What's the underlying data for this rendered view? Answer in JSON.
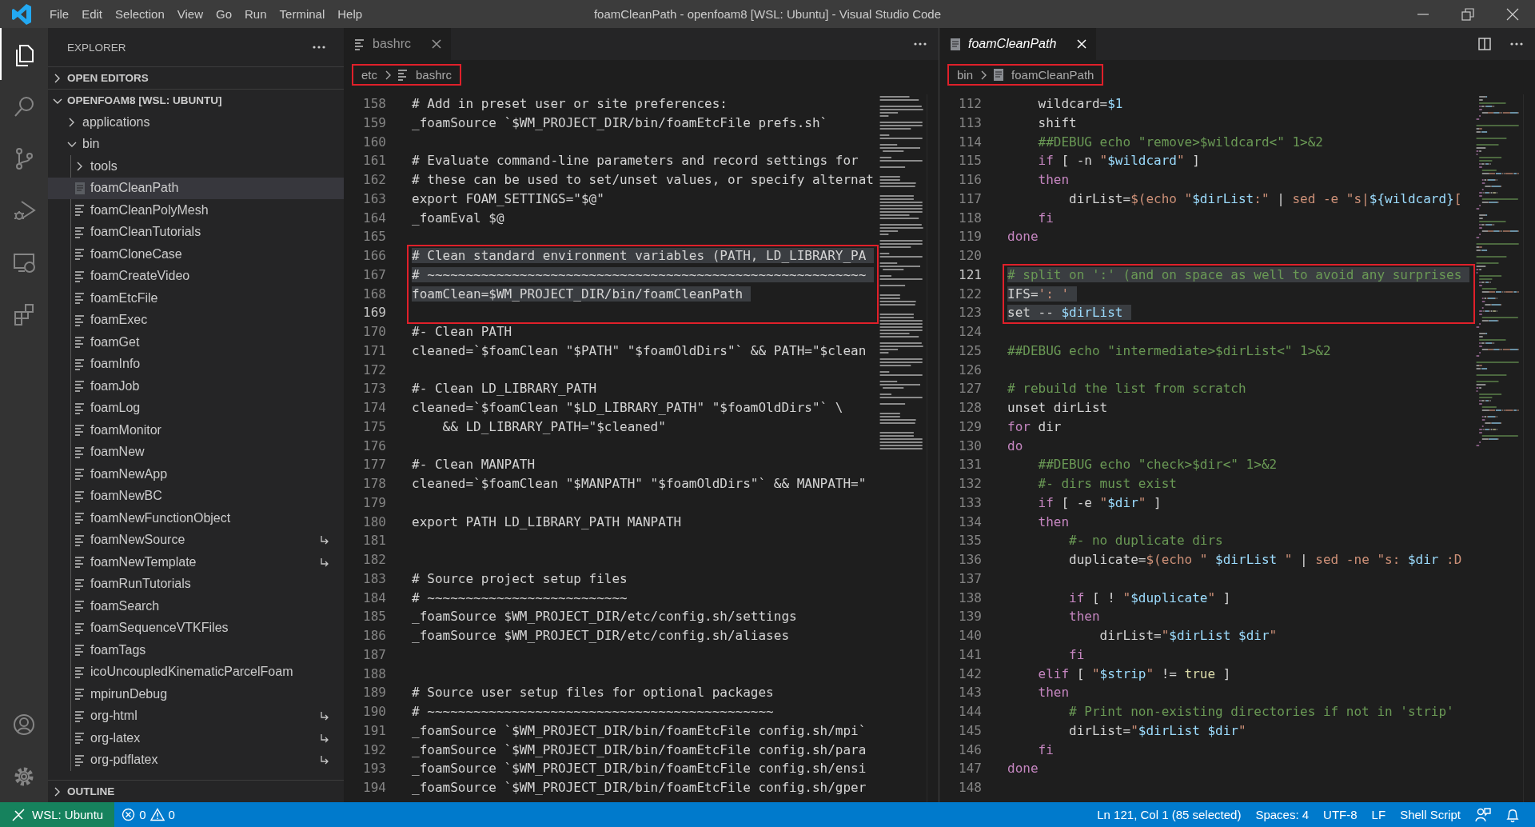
{
  "title_bar": {
    "menu": [
      "File",
      "Edit",
      "Selection",
      "View",
      "Go",
      "Run",
      "Terminal",
      "Help"
    ],
    "title": "foamCleanPath - openfoam8 [WSL: Ubuntu] - Visual Studio Code"
  },
  "activity_bar": {
    "top": [
      {
        "kind": "explorer",
        "selected": true
      },
      {
        "kind": "search",
        "selected": false
      },
      {
        "kind": "source_control",
        "selected": false
      },
      {
        "kind": "run",
        "selected": false
      },
      {
        "kind": "remote",
        "selected": false
      },
      {
        "kind": "extensions",
        "selected": false
      }
    ],
    "bottom": [
      {
        "kind": "account"
      },
      {
        "kind": "settings"
      }
    ]
  },
  "sidebar": {
    "title": "EXPLORER",
    "sections": [
      {
        "label": "OPEN EDITORS",
        "expanded": false
      },
      {
        "label": "OPENFOAM8 [WSL: UBUNTU]",
        "expanded": true,
        "tree": [
          {
            "label": "applications",
            "kind": "folder",
            "expanded": false,
            "selected": false
          },
          {
            "label": "bin",
            "kind": "folder",
            "expanded": true,
            "selected": false,
            "children": [
              {
                "label": "tools",
                "kind": "folder",
                "expanded": false,
                "selected": false
              },
              {
                "label": "foamCleanPath",
                "kind": "shellfile",
                "selected": true,
                "symlink": false
              },
              {
                "label": "foamCleanPolyMesh",
                "kind": "file",
                "selected": false,
                "symlink": false
              },
              {
                "label": "foamCleanTutorials",
                "kind": "file",
                "selected": false,
                "symlink": false
              },
              {
                "label": "foamCloneCase",
                "kind": "file",
                "selected": false,
                "symlink": false
              },
              {
                "label": "foamCreateVideo",
                "kind": "file",
                "selected": false,
                "symlink": false
              },
              {
                "label": "foamEtcFile",
                "kind": "file",
                "selected": false,
                "symlink": false
              },
              {
                "label": "foamExec",
                "kind": "file",
                "selected": false,
                "symlink": false
              },
              {
                "label": "foamGet",
                "kind": "file",
                "selected": false,
                "symlink": false
              },
              {
                "label": "foamInfo",
                "kind": "file",
                "selected": false,
                "symlink": false
              },
              {
                "label": "foamJob",
                "kind": "file",
                "selected": false,
                "symlink": false
              },
              {
                "label": "foamLog",
                "kind": "file",
                "selected": false,
                "symlink": false
              },
              {
                "label": "foamMonitor",
                "kind": "file",
                "selected": false,
                "symlink": false
              },
              {
                "label": "foamNew",
                "kind": "file",
                "selected": false,
                "symlink": false
              },
              {
                "label": "foamNewApp",
                "kind": "file",
                "selected": false,
                "symlink": false
              },
              {
                "label": "foamNewBC",
                "kind": "file",
                "selected": false,
                "symlink": false
              },
              {
                "label": "foamNewFunctionObject",
                "kind": "file",
                "selected": false,
                "symlink": false
              },
              {
                "label": "foamNewSource",
                "kind": "file",
                "selected": false,
                "symlink": true
              },
              {
                "label": "foamNewTemplate",
                "kind": "file",
                "selected": false,
                "symlink": true
              },
              {
                "label": "foamRunTutorials",
                "kind": "file",
                "selected": false,
                "symlink": false
              },
              {
                "label": "foamSearch",
                "kind": "file",
                "selected": false,
                "symlink": false
              },
              {
                "label": "foamSequenceVTKFiles",
                "kind": "file",
                "selected": false,
                "symlink": false
              },
              {
                "label": "foamTags",
                "kind": "file",
                "selected": false,
                "symlink": false
              },
              {
                "label": "icoUncoupledKinematicParcelFoam",
                "kind": "file",
                "selected": false,
                "symlink": false
              },
              {
                "label": "mpirunDebug",
                "kind": "file",
                "selected": false,
                "symlink": false
              },
              {
                "label": "org-html",
                "kind": "file",
                "selected": false,
                "symlink": true
              },
              {
                "label": "org-latex",
                "kind": "file",
                "selected": false,
                "symlink": true
              },
              {
                "label": "org-pdflatex",
                "kind": "file",
                "selected": false,
                "symlink": true
              }
            ]
          }
        ]
      },
      {
        "label": "OUTLINE",
        "expanded": false
      }
    ]
  },
  "editors": [
    {
      "focused": false,
      "tabs": [
        {
          "label": "bashrc",
          "kind": "lines",
          "selected": true,
          "preview": false
        }
      ],
      "actions": [
        {
          "kind": "more"
        }
      ],
      "breadcrumbs": {
        "boxed": true,
        "items": [
          {
            "label": "etc",
            "kind": "folder"
          },
          {
            "label": "bashrc",
            "kind": "lines"
          }
        ]
      },
      "blocks": [
        {
          "boxed": false,
          "lines": [
            {
              "n": "158",
              "selected": false,
              "current": false,
              "text": "# Add in preset user or site preferences:"
            },
            {
              "n": "159",
              "selected": false,
              "current": false,
              "text": "_foamSource `$WM_PROJECT_DIR/bin/foamEtcFile prefs.sh`"
            },
            {
              "n": "160",
              "selected": false,
              "current": false
            },
            {
              "n": "161",
              "selected": false,
              "current": false,
              "text": "# Evaluate command-line parameters and record settings for"
            },
            {
              "n": "162",
              "selected": false,
              "current": false,
              "text": "# these can be used to set/unset values, or specify alternat"
            },
            {
              "n": "163",
              "selected": false,
              "current": false,
              "text": "export FOAM_SETTINGS=\"$@\""
            },
            {
              "n": "164",
              "selected": false,
              "current": false,
              "text": "_foamEval $@"
            },
            {
              "n": "165",
              "selected": false,
              "current": false
            }
          ]
        },
        {
          "boxed": true,
          "lines": [
            {
              "n": "166",
              "selected": true,
              "current": false,
              "text": "# Clean standard environment variables (PATH, LD_LIBRARY_PA"
            },
            {
              "n": "167",
              "selected": true,
              "current": false,
              "text": "# ~~~~~~~~~~~~~~~~~~~~~~~~~~~~~~~~~~~~~~~~~~~~~~~~~~~~~~~~~"
            },
            {
              "n": "168",
              "selected": true,
              "current": false,
              "text": "foamClean=$WM_PROJECT_DIR/bin/foamCleanPath"
            },
            {
              "n": "169",
              "selected": false,
              "current": true
            }
          ]
        },
        {
          "boxed": false,
          "lines": [
            {
              "n": "170",
              "selected": false,
              "current": false,
              "text": "#- Clean PATH"
            },
            {
              "n": "171",
              "selected": false,
              "current": false,
              "text": "cleaned=`$foamClean \"$PATH\" \"$foamOldDirs\"` && PATH=\"$clean"
            },
            {
              "n": "172",
              "selected": false,
              "current": false
            },
            {
              "n": "173",
              "selected": false,
              "current": false,
              "text": "#- Clean LD_LIBRARY_PATH"
            },
            {
              "n": "174",
              "selected": false,
              "current": false,
              "text": "cleaned=`$foamClean \"$LD_LIBRARY_PATH\" \"$foamOldDirs\"` \\"
            },
            {
              "n": "175",
              "selected": false,
              "current": false,
              "text": "    && LD_LIBRARY_PATH=\"$cleaned\""
            },
            {
              "n": "176",
              "selected": false,
              "current": false
            },
            {
              "n": "177",
              "selected": false,
              "current": false,
              "text": "#- Clean MANPATH"
            },
            {
              "n": "178",
              "selected": false,
              "current": false,
              "text": "cleaned=`$foamClean \"$MANPATH\" \"$foamOldDirs\"` && MANPATH=\""
            },
            {
              "n": "179",
              "selected": false,
              "current": false
            },
            {
              "n": "180",
              "selected": false,
              "current": false,
              "text": "export PATH LD_LIBRARY_PATH MANPATH"
            },
            {
              "n": "181",
              "selected": false,
              "current": false
            },
            {
              "n": "182",
              "selected": false,
              "current": false
            },
            {
              "n": "183",
              "selected": false,
              "current": false,
              "text": "# Source project setup files"
            },
            {
              "n": "184",
              "selected": false,
              "current": false,
              "text": "# ~~~~~~~~~~~~~~~~~~~~~~~~~~"
            },
            {
              "n": "185",
              "selected": false,
              "current": false,
              "text": "_foamSource $WM_PROJECT_DIR/etc/config.sh/settings"
            },
            {
              "n": "186",
              "selected": false,
              "current": false,
              "text": "_foamSource $WM_PROJECT_DIR/etc/config.sh/aliases"
            },
            {
              "n": "187",
              "selected": false,
              "current": false
            },
            {
              "n": "188",
              "selected": false,
              "current": false
            },
            {
              "n": "189",
              "selected": false,
              "current": false,
              "text": "# Source user setup files for optional packages"
            },
            {
              "n": "190",
              "selected": false,
              "current": false,
              "text": "# ~~~~~~~~~~~~~~~~~~~~~~~~~~~~~~~~~~~~~~~~~~~~~"
            },
            {
              "n": "191",
              "selected": false,
              "current": false,
              "text": "_foamSource `$WM_PROJECT_DIR/bin/foamEtcFile config.sh/mpi`"
            },
            {
              "n": "192",
              "selected": false,
              "current": false,
              "text": "_foamSource `$WM_PROJECT_DIR/bin/foamEtcFile config.sh/para"
            },
            {
              "n": "193",
              "selected": false,
              "current": false,
              "text": "_foamSource `$WM_PROJECT_DIR/bin/foamEtcFile config.sh/ensi"
            },
            {
              "n": "194",
              "selected": false,
              "current": false,
              "text": "_foamSource `$WM_PROJECT_DIR/bin/foamEtcFile config.sh/gper"
            }
          ]
        }
      ]
    },
    {
      "focused": true,
      "tabs": [
        {
          "label": "foamCleanPath",
          "kind": "doc",
          "selected": true,
          "preview": true
        }
      ],
      "actions": [
        {
          "kind": "split"
        },
        {
          "kind": "more"
        }
      ],
      "breadcrumbs": {
        "boxed": true,
        "items": [
          {
            "label": "bin",
            "kind": "folder"
          },
          {
            "label": "foamCleanPath",
            "kind": "doc"
          }
        ]
      },
      "blocks": [
        {
          "boxed": false,
          "lines": [
            {
              "n": "112",
              "selected": false,
              "current": false,
              "tokens": [
                {
                  "kind": "plain",
                  "text": "    wildcard="
                },
                {
                  "kind": "variable",
                  "text": "$1"
                }
              ]
            },
            {
              "n": "113",
              "selected": false,
              "current": false,
              "tokens": [
                {
                  "kind": "plain",
                  "text": "    shift"
                }
              ]
            },
            {
              "n": "114",
              "selected": false,
              "current": false,
              "tokens": [
                {
                  "kind": "comment",
                  "text": "    ##DEBUG echo \"remove>$wildcard<\" 1>&2"
                }
              ]
            },
            {
              "n": "115",
              "selected": false,
              "current": false,
              "tokens": [
                {
                  "kind": "keyword",
                  "text": "    if"
                },
                {
                  "kind": "plain",
                  "text": " [ -n "
                },
                {
                  "kind": "string",
                  "text": "\""
                },
                {
                  "kind": "variable",
                  "text": "$wildcard"
                },
                {
                  "kind": "string",
                  "text": "\""
                },
                {
                  "kind": "plain",
                  "text": " ]"
                }
              ]
            },
            {
              "n": "116",
              "selected": false,
              "current": false,
              "tokens": [
                {
                  "kind": "keyword",
                  "text": "    then"
                }
              ]
            },
            {
              "n": "117",
              "selected": false,
              "current": false,
              "tokens": [
                {
                  "kind": "plain",
                  "text": "        dirList="
                },
                {
                  "kind": "string",
                  "text": "$(echo \""
                },
                {
                  "kind": "variable",
                  "text": "$dirList"
                },
                {
                  "kind": "string",
                  "text": ":\""
                },
                {
                  "kind": "plain",
                  "text": " | "
                },
                {
                  "kind": "string",
                  "text": "sed -e \"s|"
                },
                {
                  "kind": "variable",
                  "text": "${wildcard}"
                },
                {
                  "kind": "string",
                  "text": "["
                }
              ]
            },
            {
              "n": "118",
              "selected": false,
              "current": false,
              "tokens": [
                {
                  "kind": "keyword",
                  "text": "    fi"
                }
              ]
            },
            {
              "n": "119",
              "selected": false,
              "current": false,
              "tokens": [
                {
                  "kind": "keyword",
                  "text": "done"
                }
              ]
            },
            {
              "n": "120",
              "selected": false,
              "current": false
            }
          ]
        },
        {
          "boxed": true,
          "lines": [
            {
              "n": "121",
              "selected": true,
              "current": true,
              "tokens": [
                {
                  "kind": "comment",
                  "text": "# split on ':' (and on space as well to avoid any surprises"
                }
              ]
            },
            {
              "n": "122",
              "selected": true,
              "current": false,
              "tokens": [
                {
                  "kind": "plain",
                  "text": "IFS="
                },
                {
                  "kind": "string",
                  "text": "': '"
                }
              ]
            },
            {
              "n": "123",
              "selected": true,
              "current": false,
              "tokens": [
                {
                  "kind": "plain",
                  "text": "set -- "
                },
                {
                  "kind": "variable",
                  "text": "$dirList"
                }
              ]
            }
          ]
        },
        {
          "boxed": false,
          "lines": [
            {
              "n": "124",
              "selected": false,
              "current": false
            },
            {
              "n": "125",
              "selected": false,
              "current": false,
              "tokens": [
                {
                  "kind": "comment",
                  "text": "##DEBUG echo \"intermediate>$dirList<\" 1>&2"
                }
              ]
            },
            {
              "n": "126",
              "selected": false,
              "current": false
            },
            {
              "n": "127",
              "selected": false,
              "current": false,
              "tokens": [
                {
                  "kind": "comment",
                  "text": "# rebuild the list from scratch"
                }
              ]
            },
            {
              "n": "128",
              "selected": false,
              "current": false,
              "tokens": [
                {
                  "kind": "plain",
                  "text": "unset dirList"
                }
              ]
            },
            {
              "n": "129",
              "selected": false,
              "current": false,
              "tokens": [
                {
                  "kind": "keyword",
                  "text": "for"
                },
                {
                  "kind": "plain",
                  "text": " dir"
                }
              ]
            },
            {
              "n": "130",
              "selected": false,
              "current": false,
              "tokens": [
                {
                  "kind": "keyword",
                  "text": "do"
                }
              ]
            },
            {
              "n": "131",
              "selected": false,
              "current": false,
              "tokens": [
                {
                  "kind": "comment",
                  "text": "    ##DEBUG echo \"check>$dir<\" 1>&2"
                }
              ]
            },
            {
              "n": "132",
              "selected": false,
              "current": false,
              "tokens": [
                {
                  "kind": "comment",
                  "text": "    #- dirs must exist"
                }
              ]
            },
            {
              "n": "133",
              "selected": false,
              "current": false,
              "tokens": [
                {
                  "kind": "keyword",
                  "text": "    if"
                },
                {
                  "kind": "plain",
                  "text": " [ -e "
                },
                {
                  "kind": "string",
                  "text": "\""
                },
                {
                  "kind": "variable",
                  "text": "$dir"
                },
                {
                  "kind": "string",
                  "text": "\""
                },
                {
                  "kind": "plain",
                  "text": " ]"
                }
              ]
            },
            {
              "n": "134",
              "selected": false,
              "current": false,
              "tokens": [
                {
                  "kind": "keyword",
                  "text": "    then"
                }
              ]
            },
            {
              "n": "135",
              "selected": false,
              "current": false,
              "tokens": [
                {
                  "kind": "comment",
                  "text": "        #- no duplicate dirs"
                }
              ]
            },
            {
              "n": "136",
              "selected": false,
              "current": false,
              "tokens": [
                {
                  "kind": "plain",
                  "text": "        duplicate="
                },
                {
                  "kind": "string",
                  "text": "$(echo \" "
                },
                {
                  "kind": "variable",
                  "text": "$dirList"
                },
                {
                  "kind": "string",
                  "text": " \""
                },
                {
                  "kind": "plain",
                  "text": " | "
                },
                {
                  "kind": "string",
                  "text": "sed -ne \"s: "
                },
                {
                  "kind": "variable",
                  "text": "$dir"
                },
                {
                  "kind": "string",
                  "text": " :D"
                }
              ]
            },
            {
              "n": "137",
              "selected": false,
              "current": false
            },
            {
              "n": "138",
              "selected": false,
              "current": false,
              "tokens": [
                {
                  "kind": "keyword",
                  "text": "        if"
                },
                {
                  "kind": "plain",
                  "text": " [ ! "
                },
                {
                  "kind": "string",
                  "text": "\""
                },
                {
                  "kind": "variable",
                  "text": "$duplicate"
                },
                {
                  "kind": "string",
                  "text": "\""
                },
                {
                  "kind": "plain",
                  "text": " ]"
                }
              ]
            },
            {
              "n": "139",
              "selected": false,
              "current": false,
              "tokens": [
                {
                  "kind": "keyword",
                  "text": "        then"
                }
              ]
            },
            {
              "n": "140",
              "selected": false,
              "current": false,
              "tokens": [
                {
                  "kind": "plain",
                  "text": "            dirList="
                },
                {
                  "kind": "string",
                  "text": "\""
                },
                {
                  "kind": "variable",
                  "text": "$dirList $dir"
                },
                {
                  "kind": "string",
                  "text": "\""
                }
              ]
            },
            {
              "n": "141",
              "selected": false,
              "current": false,
              "tokens": [
                {
                  "kind": "keyword",
                  "text": "        fi"
                }
              ]
            },
            {
              "n": "142",
              "selected": false,
              "current": false,
              "tokens": [
                {
                  "kind": "keyword",
                  "text": "    elif"
                },
                {
                  "kind": "plain",
                  "text": " [ "
                },
                {
                  "kind": "string",
                  "text": "\""
                },
                {
                  "kind": "variable",
                  "text": "$strip"
                },
                {
                  "kind": "string",
                  "text": "\""
                },
                {
                  "kind": "plain",
                  "text": " != "
                },
                {
                  "kind": "constant",
                  "text": "true"
                },
                {
                  "kind": "plain",
                  "text": " ]"
                }
              ]
            },
            {
              "n": "143",
              "selected": false,
              "current": false,
              "tokens": [
                {
                  "kind": "keyword",
                  "text": "    then"
                }
              ]
            },
            {
              "n": "144",
              "selected": false,
              "current": false,
              "tokens": [
                {
                  "kind": "comment",
                  "text": "        # Print non-existing directories if not in 'strip'"
                }
              ]
            },
            {
              "n": "145",
              "selected": false,
              "current": false,
              "tokens": [
                {
                  "kind": "plain",
                  "text": "        dirList="
                },
                {
                  "kind": "string",
                  "text": "\""
                },
                {
                  "kind": "variable",
                  "text": "$dirList $dir"
                },
                {
                  "kind": "string",
                  "text": "\""
                }
              ]
            },
            {
              "n": "146",
              "selected": false,
              "current": false,
              "tokens": [
                {
                  "kind": "keyword",
                  "text": "    fi"
                }
              ]
            },
            {
              "n": "147",
              "selected": false,
              "current": false,
              "tokens": [
                {
                  "kind": "keyword",
                  "text": "done"
                }
              ]
            },
            {
              "n": "148",
              "selected": false,
              "current": false
            }
          ]
        }
      ]
    }
  ],
  "status_bar": {
    "remote": "WSL: Ubuntu",
    "errors": "0",
    "warnings": "0",
    "right": [
      "Ln 121, Col 1 (85 selected)",
      "Spaces: 4",
      "UTF-8",
      "LF",
      "Shell Script"
    ],
    "icons": [
      {
        "kind": "feedback"
      },
      {
        "kind": "bell"
      }
    ]
  }
}
